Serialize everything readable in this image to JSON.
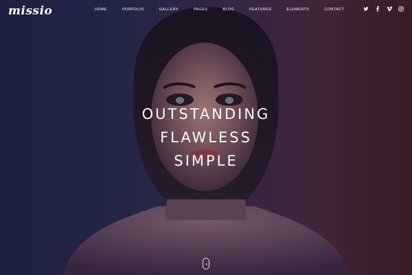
{
  "header": {
    "logo": "missio",
    "nav": [
      {
        "label": "HOME"
      },
      {
        "label": "PORFOLIO"
      },
      {
        "label": "GALLERY"
      },
      {
        "label": "PAGES"
      },
      {
        "label": "BLOG"
      },
      {
        "label": "FEATURES"
      },
      {
        "label": "ELEMENTS"
      },
      {
        "label": "CONTACT"
      }
    ],
    "social": [
      "twitter-icon",
      "facebook-icon",
      "vimeo-icon",
      "instagram-icon"
    ]
  },
  "hero": {
    "lines": [
      "OUTSTANDING",
      "FLAWLESS",
      "SIMPLE"
    ],
    "scroll_icon": "mouse-scroll-icon"
  }
}
